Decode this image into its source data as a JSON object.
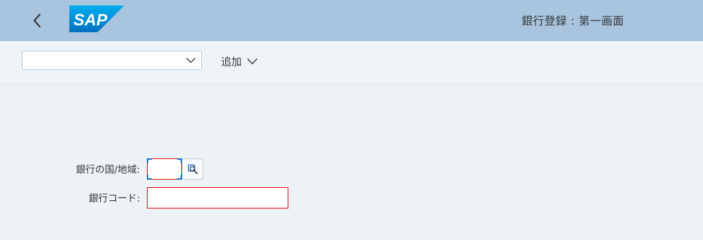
{
  "header": {
    "logo_text": "SAP",
    "title": "銀行登録 : 第一画面",
    "back_icon": "chevron-left-icon"
  },
  "toolbar": {
    "variant_value": "",
    "add_label": "追加",
    "add_icon": "chevron-down-icon"
  },
  "form": {
    "country_label": "銀行の国/地域:",
    "country_value": "",
    "value_help_icon": "value-help-search-icon",
    "bank_code_label": "銀行コード:",
    "bank_code_value": ""
  },
  "colors": {
    "header_bg": "#a9c4de",
    "page_bg": "#edf2f7",
    "logo_blue": "#0a8fe0",
    "error_border": "#e30000",
    "focus_corner": "#0a6ed1"
  }
}
